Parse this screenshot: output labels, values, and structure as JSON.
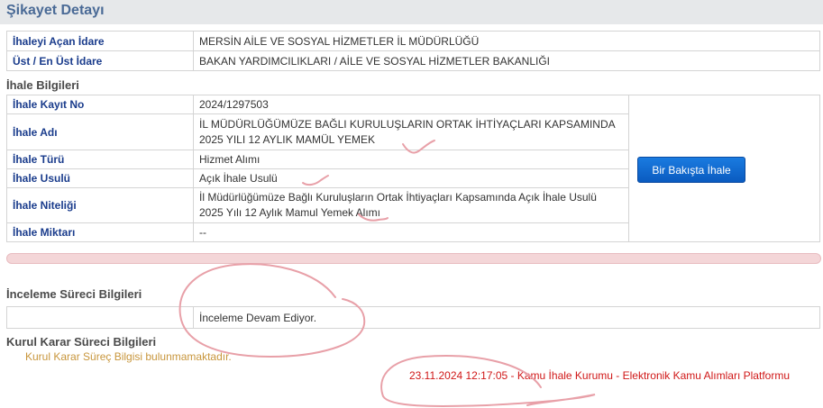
{
  "header": {
    "title": "Şikayet Detayı"
  },
  "idare": {
    "rows": [
      {
        "label": "İhaleyi Açan İdare",
        "value": "MERSİN AİLE VE SOSYAL HİZMETLER İL MÜDÜRLÜĞÜ"
      },
      {
        "label": "Üst / En Üst İdare",
        "value": "BAKAN YARDIMCILIKLARI / AİLE VE SOSYAL HİZMETLER BAKANLIĞI"
      }
    ]
  },
  "ihale": {
    "section_title": "İhale Bilgileri",
    "rows": [
      {
        "label": "İhale Kayıt No",
        "value": "2024/1297503"
      },
      {
        "label": "İhale Adı",
        "value": "İL MÜDÜRLÜĞÜMÜZE BAĞLI KURULUŞLARIN ORTAK İHTİYAÇLARI KAPSAMINDA 2025 YILI 12 AYLIK MAMÜL YEMEK"
      },
      {
        "label": "İhale Türü",
        "value": "Hizmet Alımı"
      },
      {
        "label": "İhale Usulü",
        "value": "Açık İhale Usulü"
      },
      {
        "label": "İhale Niteliği",
        "value": "İl Müdürlüğümüze Bağlı Kuruluşların Ortak İhtiyaçları Kapsamında Açık İhale Usulü 2025 Yılı 12 Aylık Mamul Yemek Alımı"
      },
      {
        "label": "İhale Miktarı",
        "value": "--"
      }
    ],
    "button_label": "Bir Bakışta İhale"
  },
  "inceleme": {
    "section_title": "İnceleme Süreci Bilgileri",
    "status": "İnceleme Devam Ediyor."
  },
  "kurul": {
    "section_title": "Kurul Karar Süreci Bilgileri",
    "message": "Kurul Karar Süreç Bilgisi bulunmamaktadır."
  },
  "footer": {
    "text": "23.11.2024 12:17:05 - Kamu İhale Kurumu - Elektronik Kamu Alımları Platformu"
  },
  "colors": {
    "label": "#1a3c8c",
    "footer": "#d01818",
    "annotation": "#e8a0a8",
    "button": "#0a5bc0"
  }
}
